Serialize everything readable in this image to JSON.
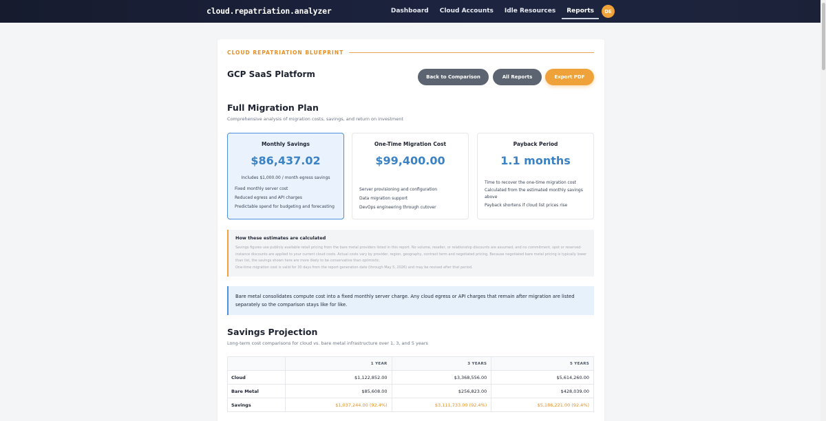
{
  "nav": {
    "brand": "cloud.repatriation.analyzer",
    "links": [
      "Dashboard",
      "Cloud Accounts",
      "Idle Resources",
      "Reports"
    ],
    "active": "Reports",
    "avatar_initials": "DE"
  },
  "header": {
    "eyebrow": "CLOUD REPATRIATION BLUEPRINT",
    "platform": "GCP SaaS Platform",
    "buttons": {
      "back": "Back to Comparison",
      "all_reports": "All Reports",
      "export": "Export PDF"
    }
  },
  "plan": {
    "title": "Full Migration Plan",
    "subtitle": "Comprehensive analysis of migration costs, savings, and return on investment"
  },
  "metrics": [
    {
      "label": "Monthly Savings",
      "value": "$86,437.02",
      "note": "Includes $1,000.00 / month egress savings",
      "items": [
        "Fixed monthly server cost",
        "Reduced egress and API charges",
        "Predictable spend for budgeting and forecasting"
      ]
    },
    {
      "label": "One-Time Migration Cost",
      "value": "$99,400.00",
      "items": [
        "Server provisioning and configuration",
        "Data migration support",
        "DevOps engineering through cutover"
      ]
    },
    {
      "label": "Payback Period",
      "value": "1.1 months",
      "items": [
        "Time to recover the one-time migration cost",
        "Calculated from the estimated monthly savings",
        "above",
        "Payback shortens if cloud list prices rise"
      ]
    }
  ],
  "calc": {
    "title": "How these estimates are calculated",
    "text": "Savings figures use publicly available retail pricing from the bare metal providers listed in this report. No volume, reseller, or relationship discounts are assumed, and no commitment, spot or reserved-instance discounts are applied to your current cloud costs. Actual costs vary by provider, region, geography, contract term and negotiated pricing. Because negotiated bare metal pricing is typically lower than list, the savings shown here are more likely to be conservative than optimistic.",
    "text2": "One-time migration cost is valid for 30 days from the report generation date (through May 5, 2026) and may be revised after that period."
  },
  "info": {
    "text": "Bare metal consolidates compute cost into a fixed monthly server charge. Any cloud egress or API charges that remain after migration are listed separately so the comparison stays like for like."
  },
  "projection": {
    "title": "Savings Projection",
    "subtitle": "Long-term cost comparisons for cloud vs. bare metal infrastructure over 1, 3, and 5 years",
    "columns": [
      "",
      "1 YEAR",
      "3 YEARS",
      "5 YEARS"
    ],
    "rows": [
      {
        "label": "Cloud",
        "values": [
          "$1,122,852.00",
          "$3,368,556.00",
          "$5,614,260.00"
        ]
      },
      {
        "label": "Bare Metal",
        "values": [
          "$85,608.00",
          "$256,823.00",
          "$428,039.00"
        ]
      },
      {
        "label": "Savings",
        "values": [
          "$1,037,244.00 (92.4%)",
          "$3,111,733.00 (92.4%)",
          "$5,186,221.00 (92.4%)"
        ]
      }
    ]
  }
}
